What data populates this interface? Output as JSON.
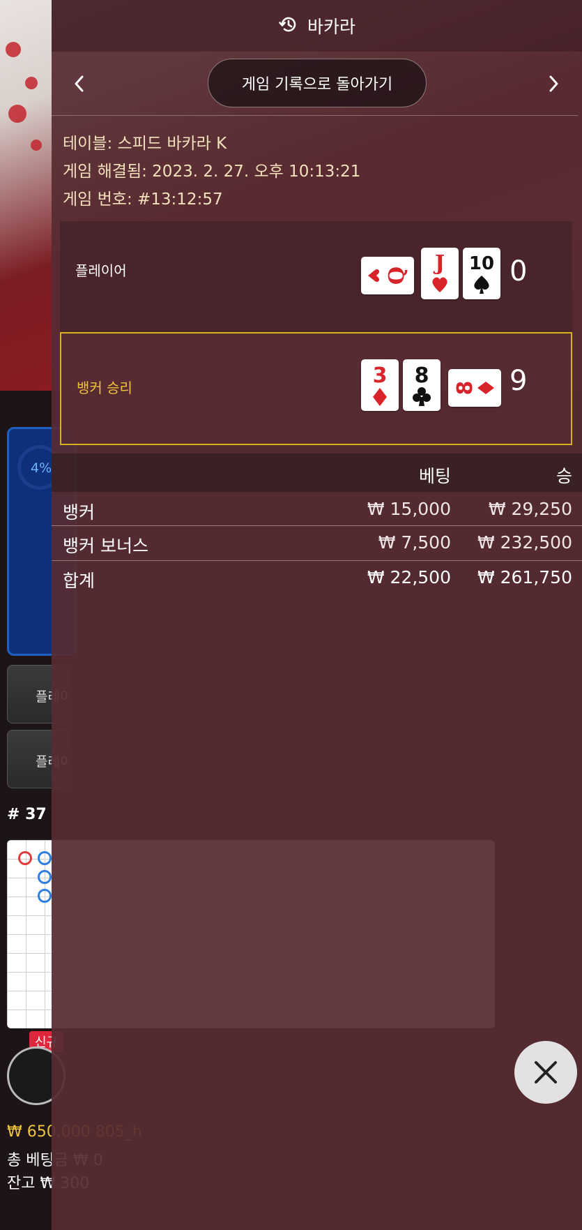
{
  "header": {
    "title": "바카라",
    "icon": "history-icon"
  },
  "nav": {
    "prev_icon": "chevron-left-icon",
    "next_icon": "chevron-right-icon",
    "back_label": "게임 기록으로 돌아가기"
  },
  "game_info": {
    "table": "테이블: 스피드 바카라 K",
    "resolved": "게임 해결됨: 2023. 2. 27. 오후 10:13:21",
    "number": "게임 번호: #13:12:57"
  },
  "player_hand": {
    "label": "플레이어",
    "score": "0",
    "cards": [
      {
        "rank": "Q",
        "suit": "hearts",
        "orientation": "sideways"
      },
      {
        "rank": "J",
        "suit": "hearts",
        "orientation": "upright"
      },
      {
        "rank": "10",
        "suit": "spades",
        "orientation": "upright"
      }
    ]
  },
  "banker_hand": {
    "label": "뱅커 승리",
    "score": "9",
    "cards": [
      {
        "rank": "3",
        "suit": "diamonds",
        "orientation": "upright"
      },
      {
        "rank": "8",
        "suit": "clubs",
        "orientation": "upright"
      },
      {
        "rank": "8",
        "suit": "diamonds",
        "orientation": "sideways"
      }
    ]
  },
  "bets": {
    "headers": {
      "bet": "베팅",
      "win": "승"
    },
    "rows": [
      {
        "name": "뱅커",
        "bet": "₩ 15,000",
        "win": "₩ 29,250"
      },
      {
        "name": "뱅커 보너스",
        "bet": "₩ 7,500",
        "win": "₩ 232,500"
      }
    ],
    "total": {
      "name": "합계",
      "bet": "₩ 22,500",
      "win": "₩ 261,750"
    }
  },
  "close_icon": "close-icon",
  "background": {
    "progress_text": "4%",
    "side_button_1": "플레이어 승",
    "side_button_2": "플레이어 페어",
    "round": "# 37",
    "new_badge": "신규",
    "balance_line": "₩ 650,000 805_h",
    "total_bet_line": "총 베팅금 ₩ 0",
    "balance_label_line": "잔고 ₩ 300"
  },
  "colors": {
    "banker_highlight": "#d8b21c",
    "info_text": "#f3e0bd",
    "red_suit": "#d8232a",
    "black_suit": "#111111"
  }
}
